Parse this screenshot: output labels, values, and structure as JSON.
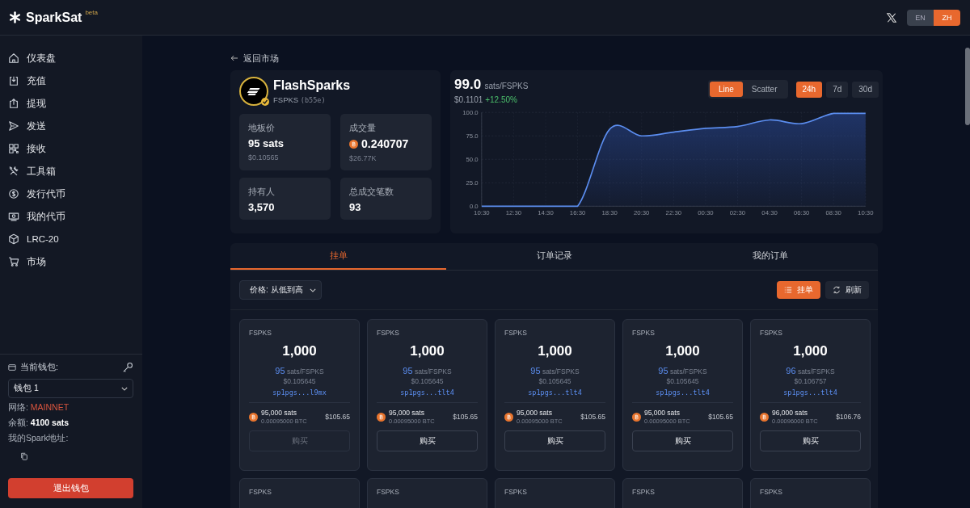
{
  "header": {
    "logo": "SparkSat",
    "badge": "beta",
    "languages": [
      {
        "label": "EN",
        "selected": false
      },
      {
        "label": "ZH",
        "selected": true
      }
    ]
  },
  "sidebar": {
    "items": [
      {
        "label": "仪表盘"
      },
      {
        "label": "充值"
      },
      {
        "label": "提现"
      },
      {
        "label": "发送"
      },
      {
        "label": "接收"
      },
      {
        "label": "工具箱"
      },
      {
        "label": "发行代币"
      },
      {
        "label": "我的代币"
      },
      {
        "label": "LRC-20"
      },
      {
        "label": "市场"
      }
    ],
    "wallet": {
      "label": "当前钱包:",
      "selected": "钱包 1",
      "network_label": "网络:",
      "network": "MAINNET",
      "balance_label": "余额:",
      "balance": "4100 sats",
      "address_label": "我的Spark地址:"
    },
    "logout": "退出钱包"
  },
  "back_link": "返回市场",
  "token": {
    "name": "FlashSparks",
    "ticker": "FSPKS",
    "id": "(b55e)",
    "verified": true,
    "stats": [
      {
        "kind": "plain",
        "label": "地板价",
        "value": "95 sats",
        "sub": "$0.10565"
      },
      {
        "kind": "btc",
        "label": "成交量",
        "value": "0.240707",
        "sub": "$26.77K"
      },
      {
        "kind": "plain",
        "label": "持有人",
        "value": "3,570"
      },
      {
        "kind": "plain",
        "label": "总成交笔数",
        "value": "93"
      }
    ]
  },
  "price": {
    "value": "99.0",
    "unit": "sats/FSPKS",
    "usd": "$0.1101",
    "change": "+12.50%"
  },
  "chart_types": [
    {
      "label": "Line",
      "selected": true
    },
    {
      "label": "Scatter",
      "selected": false
    }
  ],
  "ranges": [
    {
      "label": "24h",
      "selected": true
    },
    {
      "label": "7d",
      "selected": false
    },
    {
      "label": "30d",
      "selected": false
    }
  ],
  "chart_data": {
    "type": "area",
    "x": [
      "10:30",
      "12:30",
      "14:30",
      "16:30",
      "18:30",
      "20:30",
      "22:30",
      "00:30",
      "02:30",
      "04:30",
      "06:30",
      "08:30",
      "10:30"
    ],
    "grid": true,
    "series": [
      {
        "color": "#5b8def",
        "values": [
          0,
          0,
          0,
          0,
          82,
          75,
          79,
          83,
          85,
          92,
          88,
          99,
          99
        ]
      }
    ],
    "ylim": [
      0,
      100
    ],
    "yticks": [
      {
        "value": 0,
        "label": "0.0"
      },
      {
        "value": 25,
        "label": "25.0"
      },
      {
        "value": 50,
        "label": "50.0"
      },
      {
        "value": 75,
        "label": "75.0"
      },
      {
        "value": 100,
        "label": "100.0"
      }
    ]
  },
  "tabs": [
    {
      "label": "挂单",
      "selected": true
    },
    {
      "label": "订单记录",
      "selected": false
    },
    {
      "label": "我的订单",
      "selected": false
    }
  ],
  "sort": {
    "value": "价格: 从低到高"
  },
  "actions": [
    {
      "label": "挂单",
      "kind": "primary"
    },
    {
      "label": "刷新",
      "kind": "secondary"
    }
  ],
  "listings": [
    {
      "ticker": "FSPKS",
      "amount": "1,000",
      "price": "95",
      "unit": "sats/FSPKS",
      "usd": "$0.105645",
      "seller": "sp1pgs...l9mx",
      "total": "95,000 sats",
      "btc": "0.00095000 BTC",
      "total_usd": "$105.65",
      "button": "购买",
      "disabled": true
    },
    {
      "ticker": "FSPKS",
      "amount": "1,000",
      "price": "95",
      "unit": "sats/FSPKS",
      "usd": "$0.105645",
      "seller": "sp1pgs...tlt4",
      "total": "95,000 sats",
      "btc": "0.00095000 BTC",
      "total_usd": "$105.65",
      "button": "购买",
      "disabled": false
    },
    {
      "ticker": "FSPKS",
      "amount": "1,000",
      "price": "95",
      "unit": "sats/FSPKS",
      "usd": "$0.105645",
      "seller": "sp1pgs...tlt4",
      "total": "95,000 sats",
      "btc": "0.00095000 BTC",
      "total_usd": "$105.65",
      "button": "购买",
      "disabled": false
    },
    {
      "ticker": "FSPKS",
      "amount": "1,000",
      "price": "95",
      "unit": "sats/FSPKS",
      "usd": "$0.105645",
      "seller": "sp1pgs...tlt4",
      "total": "95,000 sats",
      "btc": "0.00095000 BTC",
      "total_usd": "$105.65",
      "button": "购买",
      "disabled": false
    },
    {
      "ticker": "FSPKS",
      "amount": "1,000",
      "price": "96",
      "unit": "sats/FSPKS",
      "usd": "$0.106757",
      "seller": "sp1pgs...tlt4",
      "total": "96,000 sats",
      "btc": "0.00096000 BTC",
      "total_usd": "$106.76",
      "button": "购买",
      "disabled": false
    },
    {
      "ticker": "FSPKS"
    },
    {
      "ticker": "FSPKS"
    },
    {
      "ticker": "FSPKS"
    },
    {
      "ticker": "FSPKS"
    },
    {
      "ticker": "FSPKS"
    }
  ]
}
